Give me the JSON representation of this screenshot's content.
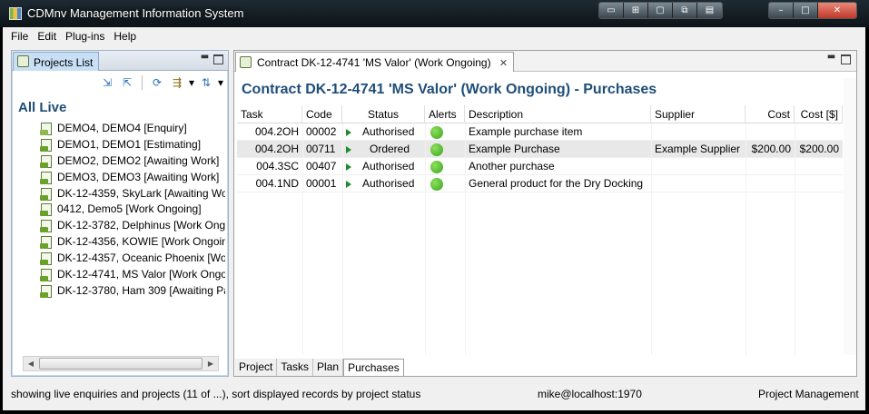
{
  "window": {
    "title": "CDMnv Management Information System",
    "controls": [
      "▭",
      "⊞",
      "▢",
      "⧉",
      "▤",
      "–",
      "□",
      "✕"
    ]
  },
  "menu": [
    "File",
    "Edit",
    "Plug-ins",
    "Help"
  ],
  "projects_panel": {
    "tab_label": "Projects List",
    "heading": "All Live",
    "items": [
      {
        "label": "DEMO4, DEMO4 [Enquiry]",
        "icon": "enquiry-project-icon"
      },
      {
        "label": "DEMO1, DEMO1 [Estimating]",
        "icon": "project-icon"
      },
      {
        "label": "DEMO2, DEMO2 [Awaiting Work]",
        "icon": "project-icon"
      },
      {
        "label": "DEMO3, DEMO3 [Awaiting Work]",
        "icon": "project-icon"
      },
      {
        "label": "DK-12-4359, SkyLark [Awaiting Wo",
        "icon": "project-icon"
      },
      {
        "label": "0412, Demo5 [Work Ongoing]",
        "icon": "project-icon"
      },
      {
        "label": "DK-12-3782, Delphinus [Work Ongo",
        "icon": "project-icon"
      },
      {
        "label": "DK-12-4356, KOWIE [Work Ongoing",
        "icon": "project-icon"
      },
      {
        "label": "DK-12-4357, Oceanic Phoenix [Wor",
        "icon": "project-icon"
      },
      {
        "label": "DK-12-4741, MS Valor [Work Ongo",
        "icon": "project-icon"
      },
      {
        "label": "DK-12-3780, Ham 309 [Awaiting Pa",
        "icon": "project-icon"
      }
    ]
  },
  "editor": {
    "tab_label": "Contract DK-12-4741 'MS Valor' (Work Ongoing)",
    "title": "Contract DK-12-4741 'MS Valor' (Work Ongoing) - Purchases",
    "columns": [
      "Task",
      "Code",
      "Status",
      "Alerts",
      "Description",
      "Supplier",
      "Cost",
      "Cost [$]"
    ],
    "rows": [
      {
        "task": "004.2OH",
        "code": "00002",
        "status": "Authorised",
        "alert": "green",
        "description": "Example purchase item",
        "supplier": "",
        "cost": "",
        "cost_usd": "",
        "selected": false
      },
      {
        "task": "004.2OH",
        "code": "00711",
        "status": "Ordered",
        "alert": "green",
        "description": "Example Purchase",
        "supplier": "Example Supplier",
        "cost": "$200.00",
        "cost_usd": "$200.00",
        "selected": true
      },
      {
        "task": "004.3SC",
        "code": "00407",
        "status": "Authorised",
        "alert": "green",
        "description": "Another purchase",
        "supplier": "",
        "cost": "",
        "cost_usd": "",
        "selected": false
      },
      {
        "task": "004.1ND",
        "code": "00001",
        "status": "Authorised",
        "alert": "green",
        "description": "General product for the Dry Docking",
        "supplier": "",
        "cost": "",
        "cost_usd": "",
        "selected": false
      }
    ],
    "bottom_tabs": [
      "Project",
      "Tasks",
      "Plan",
      "Purchases"
    ],
    "active_bottom_tab": "Purchases"
  },
  "statusbar": {
    "message": "showing live enquiries and projects (11 of ...), sort displayed records by project status",
    "user": "mike@localhost:1970",
    "perspective": "Project Management"
  },
  "colors": {
    "heading_blue": "#1f4e79",
    "alert_green": "#3aa420",
    "status_arrow_green": "#1e8a2e"
  }
}
